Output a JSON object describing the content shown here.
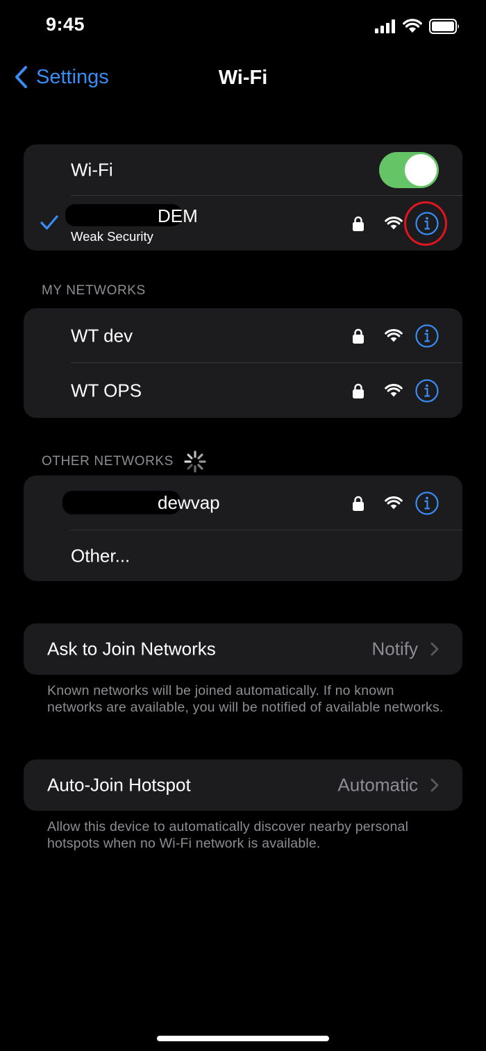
{
  "status_bar": {
    "time": "9:45",
    "icons": [
      "cellular-signal-icon",
      "wifi-icon",
      "battery-icon"
    ]
  },
  "nav": {
    "back_label": "Settings",
    "title": "Wi-Fi"
  },
  "wifi_toggle": {
    "label": "Wi-Fi",
    "enabled": true,
    "on_color": "#65c466"
  },
  "current_network": {
    "name_visible": "DEM",
    "subtitle": "Weak Security",
    "connected": true,
    "secured": true,
    "info_highlighted": true
  },
  "my_networks": {
    "header": "MY NETWORKS",
    "items": [
      {
        "name": "WT dev",
        "secured": true
      },
      {
        "name": "WT OPS",
        "secured": true
      }
    ]
  },
  "other_networks": {
    "header": "OTHER NETWORKS",
    "scanning": true,
    "items": [
      {
        "name_visible": "dewvap",
        "secured": true
      }
    ],
    "other_label": "Other..."
  },
  "ask_to_join": {
    "label": "Ask to Join Networks",
    "value": "Notify",
    "footnote": "Known networks will be joined automatically. If no known networks are available, you will be notified of available networks."
  },
  "auto_join_hotspot": {
    "label": "Auto-Join Hotspot",
    "value": "Automatic",
    "footnote": "Allow this device to automatically discover nearby personal hotspots when no Wi-Fi network is available."
  },
  "colors": {
    "accent": "#3a8cf5",
    "background": "#000000",
    "cell": "#1c1c1e",
    "secondary_text": "#8d8d93",
    "highlight": "#e0161f"
  }
}
